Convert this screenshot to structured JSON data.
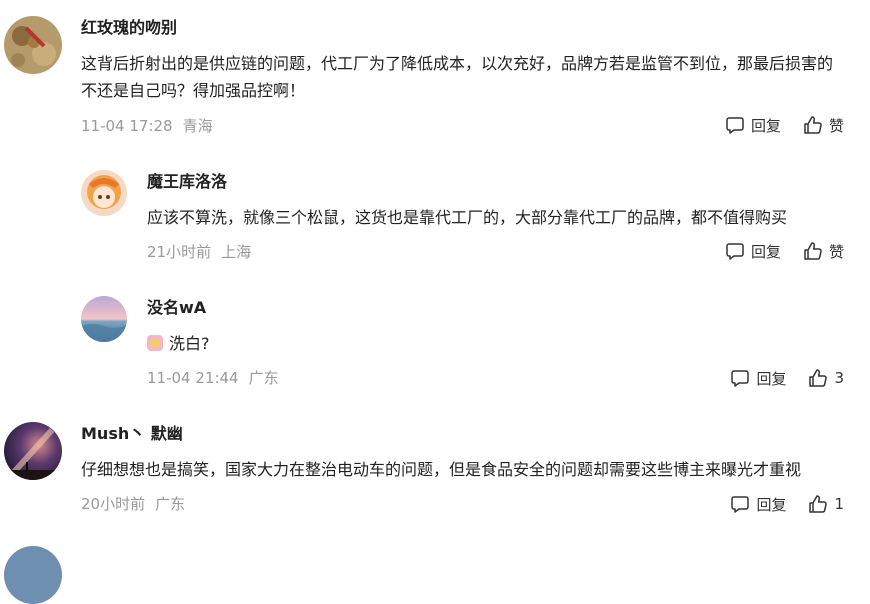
{
  "comments": [
    {
      "username": "红玫瑰的吻别",
      "text": "这背后折射出的是供应链的问题，代工厂为了降低成本，以次充好，品牌方若是监管不到位，那最后损害的不还是自己吗？得加强品控啊！",
      "time": "11-04 17:28",
      "location": "青海",
      "reply_label": "回复",
      "like_label": "赞"
    },
    {
      "username": "魔王库洛洛",
      "text": "应该不算洗，就像三个松鼠，这货也是靠代工厂的，大部分靠代工厂的品牌，都不值得购买",
      "time": "21小时前",
      "location": "上海",
      "reply_label": "回复",
      "like_label": "赞"
    },
    {
      "username": "没名wA",
      "text": "洗白?",
      "time": "11-04 21:44",
      "location": "广东",
      "reply_label": "回复",
      "like_label": "3"
    },
    {
      "username": "Mush丶 默幽",
      "text": "仔细想想也是搞笑，国家大力在整治电动车的问题，但是食品安全的问题却需要这些博主来曝光才重视",
      "time": "20小时前",
      "location": "广东",
      "reply_label": "回复",
      "like_label": "1"
    }
  ],
  "icons": {
    "reply": "comment-bubble-icon",
    "like": "thumbs-up-icon"
  },
  "colors": {
    "meta": "#9a9a9a",
    "text": "#222222"
  }
}
